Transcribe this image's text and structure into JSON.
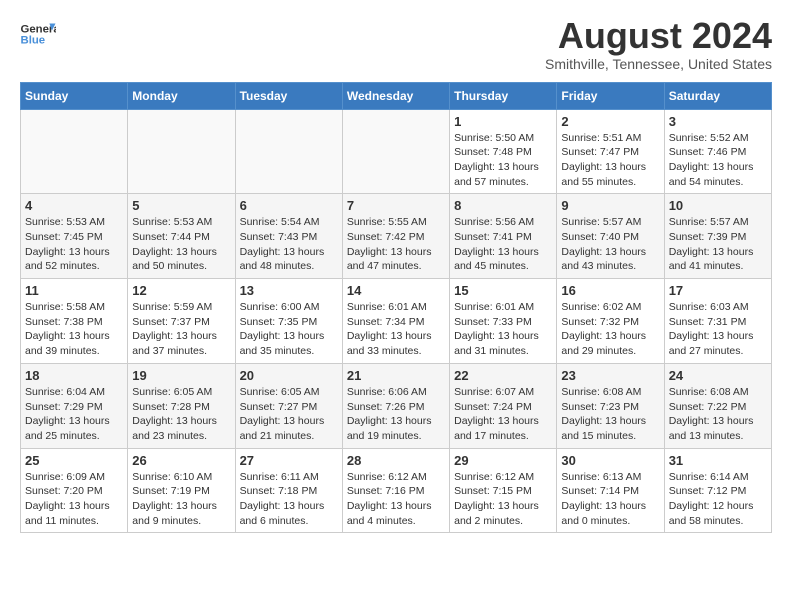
{
  "header": {
    "logo_line1": "General",
    "logo_line2": "Blue",
    "title": "August 2024",
    "subtitle": "Smithville, Tennessee, United States"
  },
  "calendar": {
    "days_of_week": [
      "Sunday",
      "Monday",
      "Tuesday",
      "Wednesday",
      "Thursday",
      "Friday",
      "Saturday"
    ],
    "weeks": [
      [
        {
          "day": "",
          "info": ""
        },
        {
          "day": "",
          "info": ""
        },
        {
          "day": "",
          "info": ""
        },
        {
          "day": "",
          "info": ""
        },
        {
          "day": "1",
          "info": "Sunrise: 5:50 AM\nSunset: 7:48 PM\nDaylight: 13 hours\nand 57 minutes."
        },
        {
          "day": "2",
          "info": "Sunrise: 5:51 AM\nSunset: 7:47 PM\nDaylight: 13 hours\nand 55 minutes."
        },
        {
          "day": "3",
          "info": "Sunrise: 5:52 AM\nSunset: 7:46 PM\nDaylight: 13 hours\nand 54 minutes."
        }
      ],
      [
        {
          "day": "4",
          "info": "Sunrise: 5:53 AM\nSunset: 7:45 PM\nDaylight: 13 hours\nand 52 minutes."
        },
        {
          "day": "5",
          "info": "Sunrise: 5:53 AM\nSunset: 7:44 PM\nDaylight: 13 hours\nand 50 minutes."
        },
        {
          "day": "6",
          "info": "Sunrise: 5:54 AM\nSunset: 7:43 PM\nDaylight: 13 hours\nand 48 minutes."
        },
        {
          "day": "7",
          "info": "Sunrise: 5:55 AM\nSunset: 7:42 PM\nDaylight: 13 hours\nand 47 minutes."
        },
        {
          "day": "8",
          "info": "Sunrise: 5:56 AM\nSunset: 7:41 PM\nDaylight: 13 hours\nand 45 minutes."
        },
        {
          "day": "9",
          "info": "Sunrise: 5:57 AM\nSunset: 7:40 PM\nDaylight: 13 hours\nand 43 minutes."
        },
        {
          "day": "10",
          "info": "Sunrise: 5:57 AM\nSunset: 7:39 PM\nDaylight: 13 hours\nand 41 minutes."
        }
      ],
      [
        {
          "day": "11",
          "info": "Sunrise: 5:58 AM\nSunset: 7:38 PM\nDaylight: 13 hours\nand 39 minutes."
        },
        {
          "day": "12",
          "info": "Sunrise: 5:59 AM\nSunset: 7:37 PM\nDaylight: 13 hours\nand 37 minutes."
        },
        {
          "day": "13",
          "info": "Sunrise: 6:00 AM\nSunset: 7:35 PM\nDaylight: 13 hours\nand 35 minutes."
        },
        {
          "day": "14",
          "info": "Sunrise: 6:01 AM\nSunset: 7:34 PM\nDaylight: 13 hours\nand 33 minutes."
        },
        {
          "day": "15",
          "info": "Sunrise: 6:01 AM\nSunset: 7:33 PM\nDaylight: 13 hours\nand 31 minutes."
        },
        {
          "day": "16",
          "info": "Sunrise: 6:02 AM\nSunset: 7:32 PM\nDaylight: 13 hours\nand 29 minutes."
        },
        {
          "day": "17",
          "info": "Sunrise: 6:03 AM\nSunset: 7:31 PM\nDaylight: 13 hours\nand 27 minutes."
        }
      ],
      [
        {
          "day": "18",
          "info": "Sunrise: 6:04 AM\nSunset: 7:29 PM\nDaylight: 13 hours\nand 25 minutes."
        },
        {
          "day": "19",
          "info": "Sunrise: 6:05 AM\nSunset: 7:28 PM\nDaylight: 13 hours\nand 23 minutes."
        },
        {
          "day": "20",
          "info": "Sunrise: 6:05 AM\nSunset: 7:27 PM\nDaylight: 13 hours\nand 21 minutes."
        },
        {
          "day": "21",
          "info": "Sunrise: 6:06 AM\nSunset: 7:26 PM\nDaylight: 13 hours\nand 19 minutes."
        },
        {
          "day": "22",
          "info": "Sunrise: 6:07 AM\nSunset: 7:24 PM\nDaylight: 13 hours\nand 17 minutes."
        },
        {
          "day": "23",
          "info": "Sunrise: 6:08 AM\nSunset: 7:23 PM\nDaylight: 13 hours\nand 15 minutes."
        },
        {
          "day": "24",
          "info": "Sunrise: 6:08 AM\nSunset: 7:22 PM\nDaylight: 13 hours\nand 13 minutes."
        }
      ],
      [
        {
          "day": "25",
          "info": "Sunrise: 6:09 AM\nSunset: 7:20 PM\nDaylight: 13 hours\nand 11 minutes."
        },
        {
          "day": "26",
          "info": "Sunrise: 6:10 AM\nSunset: 7:19 PM\nDaylight: 13 hours\nand 9 minutes."
        },
        {
          "day": "27",
          "info": "Sunrise: 6:11 AM\nSunset: 7:18 PM\nDaylight: 13 hours\nand 6 minutes."
        },
        {
          "day": "28",
          "info": "Sunrise: 6:12 AM\nSunset: 7:16 PM\nDaylight: 13 hours\nand 4 minutes."
        },
        {
          "day": "29",
          "info": "Sunrise: 6:12 AM\nSunset: 7:15 PM\nDaylight: 13 hours\nand 2 minutes."
        },
        {
          "day": "30",
          "info": "Sunrise: 6:13 AM\nSunset: 7:14 PM\nDaylight: 13 hours\nand 0 minutes."
        },
        {
          "day": "31",
          "info": "Sunrise: 6:14 AM\nSunset: 7:12 PM\nDaylight: 12 hours\nand 58 minutes."
        }
      ]
    ]
  }
}
